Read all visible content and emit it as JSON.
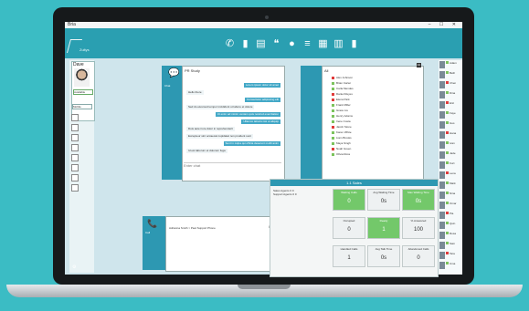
{
  "window": {
    "title": "Bria",
    "controls": "– ☐ ✕"
  },
  "topbar": {
    "logo_text": "Zultys"
  },
  "toolbar": {
    "icons": [
      "phone-icon",
      "contacts-icon",
      "notes-icon",
      "chat-icon",
      "group-chat-icon",
      "list-icon",
      "calendar-icon",
      "calendar-grid-icon",
      "stats-icon"
    ]
  },
  "user": {
    "name": "Dave",
    "status": "Available",
    "presence": "Mobile"
  },
  "chat": {
    "header": "PR Study",
    "side_label": "Chat",
    "side_sub": "Messages",
    "messages": [
      {
        "dir": "out",
        "text": "Lorem ipsum dolor sit amet"
      },
      {
        "dir": "in",
        "text": "Hello there"
      },
      {
        "dir": "out",
        "text": "Consectetur adipiscing elit"
      },
      {
        "dir": "in",
        "text": "Sed do eiusmod tempor incididunt ut labore et dolore"
      },
      {
        "dir": "out",
        "text": "Ut enim ad minim veniam quis nostrud exercitation"
      },
      {
        "dir": "out",
        "text": "Ullamco laboris nisi ut aliquip"
      },
      {
        "dir": "in",
        "text": "Duis aute irure dolor in reprehenderit"
      },
      {
        "dir": "in",
        "text": "Excepteur sint occaecat cupidatat non proident sunt"
      },
      {
        "dir": "out",
        "text": "Sunt in culpa qui officia deserunt mollit anim"
      },
      {
        "dir": "in",
        "text": "Id est laborum et dolorum fuga"
      }
    ],
    "input_placeholder": "Enter chat"
  },
  "directory": {
    "title": "All",
    "tag": "All",
    "entries": [
      {
        "name": "Alex Johnson",
        "color": "#e03b3b"
      },
      {
        "name": "Brian Carter",
        "color": "#7cc35d"
      },
      {
        "name": "Carla Mendes",
        "color": "#7cc35d"
      },
      {
        "name": "Daniel Reyes",
        "color": "#e03b3b"
      },
      {
        "name": "Elena Park",
        "color": "#e03b3b"
      },
      {
        "name": "Frank Miller",
        "color": "#7cc35d"
      },
      {
        "name": "Grace Liu",
        "color": "#7cc35d"
      },
      {
        "name": "Henry Adams",
        "color": "#7cc35d"
      },
      {
        "name": "Irene Costa",
        "color": "#7cc35d"
      },
      {
        "name": "Jacob Stone",
        "color": "#e03b3b"
      },
      {
        "name": "Karen White",
        "color": "#7cc35d"
      },
      {
        "name": "Liam Brooks",
        "color": "#7cc35d"
      },
      {
        "name": "Maya Singh",
        "color": "#7cc35d"
      },
      {
        "name": "Noah Green",
        "color": "#e03b3b"
      },
      {
        "name": "Olivia Ross",
        "color": "#7cc35d"
      }
    ]
  },
  "call": {
    "side_label": "Call",
    "text": "Adrianna Smith > Paul Support Phone",
    "pause": "II"
  },
  "stats": {
    "title": "1.1 Sales",
    "queue_rows": [
      {
        "name": "Sales Agents",
        "a": "0",
        "b": "0"
      },
      {
        "name": "Support Agents",
        "a": "0",
        "b": "0"
      }
    ],
    "tiles": [
      {
        "label": "Waiting Calls",
        "value": "0",
        "green": true
      },
      {
        "label": "Avg Waiting Time",
        "value": "0s",
        "green": false
      },
      {
        "label": "Max Waiting Time",
        "value": "0s",
        "green": true
      },
      {
        "label": "Occupied",
        "value": "0",
        "green": false
      },
      {
        "label": "Ready",
        "value": "1",
        "green": true
      },
      {
        "label": "% Answered",
        "value": "100",
        "green": false
      },
      {
        "label": "Handled Calls",
        "value": "1",
        "green": false
      },
      {
        "label": "Avg Talk Time",
        "value": "0s",
        "green": false
      },
      {
        "label": "Abandoned Calls",
        "value": "0",
        "green": false
      }
    ]
  },
  "roster": [
    {
      "name": "Adam",
      "color": "#7cc35d"
    },
    {
      "name": "Beth",
      "color": "#7cc35d"
    },
    {
      "name": "Chen",
      "color": "#e03b3b"
    },
    {
      "name": "Dina",
      "color": "#7cc35d"
    },
    {
      "name": "Eric",
      "color": "#e03b3b"
    },
    {
      "name": "Faye",
      "color": "#7cc35d"
    },
    {
      "name": "Gus",
      "color": "#7cc35d"
    },
    {
      "name": "Hana",
      "color": "#e03b3b"
    },
    {
      "name": "Ivan",
      "color": "#7cc35d"
    },
    {
      "name": "Jade",
      "color": "#7cc35d"
    },
    {
      "name": "Kurt",
      "color": "#7cc35d"
    },
    {
      "name": "Lena",
      "color": "#e03b3b"
    },
    {
      "name": "Mark",
      "color": "#7cc35d"
    },
    {
      "name": "Nina",
      "color": "#7cc35d"
    },
    {
      "name": "Omar",
      "color": "#7cc35d"
    },
    {
      "name": "Pia",
      "color": "#e03b3b"
    },
    {
      "name": "Quin",
      "color": "#7cc35d"
    },
    {
      "name": "Rosa",
      "color": "#7cc35d"
    },
    {
      "name": "Sam",
      "color": "#7cc35d"
    },
    {
      "name": "Tara",
      "color": "#e03b3b"
    },
    {
      "name": "Uma",
      "color": "#7cc35d"
    }
  ]
}
